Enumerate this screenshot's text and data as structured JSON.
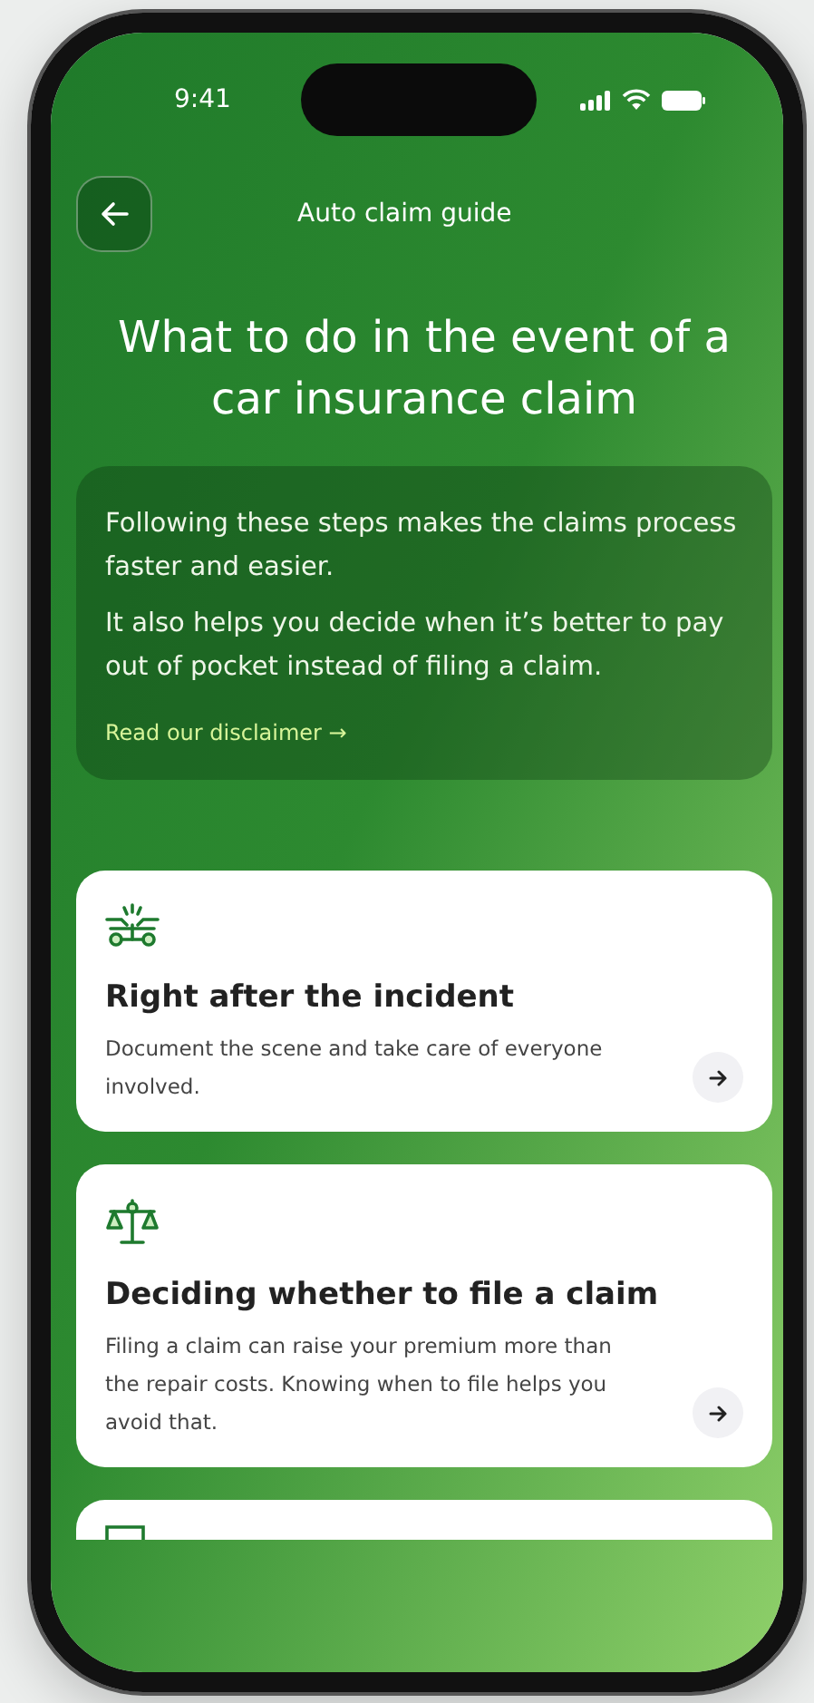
{
  "status_bar": {
    "time": "9:41"
  },
  "header": {
    "title": "Auto claim guide"
  },
  "heading": "What to do in the event of a car insurance claim",
  "intro": {
    "paragraphs": [
      "Following these steps makes the claims process faster and easier.",
      "It also helps you decide when it’s better to pay out of pocket instead of filing a claim."
    ],
    "link": "Read our disclaimer →"
  },
  "cards": [
    {
      "kind": "incident",
      "title": "Right after the incident",
      "description": "Document the scene and take care of everyone involved."
    },
    {
      "kind": "decision",
      "title": "Deciding whether to file a claim",
      "description": "Filing a claim can raise your premium more than the repair costs. Knowing when to file helps you avoid that."
    },
    {
      "kind": "cut"
    }
  ]
}
